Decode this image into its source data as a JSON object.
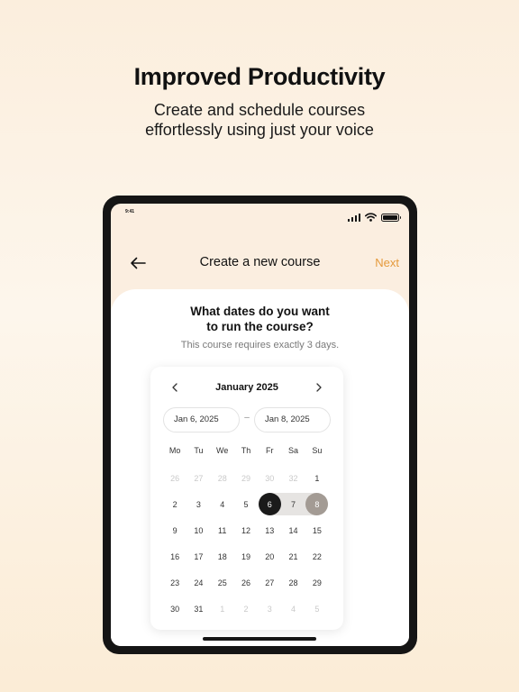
{
  "promo": {
    "headline": "Improved Productivity",
    "subline_1": "Create and schedule courses",
    "subline_2": "effortlessly using just your voice"
  },
  "status_bar": {
    "time": "9:41",
    "icons": [
      "signal-icon",
      "wifi-icon",
      "battery-icon"
    ]
  },
  "nav": {
    "title": "Create a new course",
    "next_label": "Next",
    "back_icon": "arrow-left-icon"
  },
  "question": {
    "line_1": "What dates do you want",
    "line_2": "to run the course?"
  },
  "hint": "This course requires exactly 3 days.",
  "calendar": {
    "month": "January 2025",
    "start_date": "Jan 6, 2025",
    "separator": "–",
    "end_date": "Jan 8, 2025",
    "weekdays": [
      "Mo",
      "Tu",
      "We",
      "Th",
      "Fr",
      "Sa",
      "Su"
    ],
    "weeks": [
      [
        "26",
        "27",
        "28",
        "29",
        "30",
        "32",
        "1"
      ],
      [
        "2",
        "3",
        "4",
        "5",
        "6",
        "7",
        "8"
      ],
      [
        "9",
        "10",
        "11",
        "12",
        "13",
        "14",
        "15"
      ],
      [
        "16",
        "17",
        "18",
        "19",
        "20",
        "21",
        "22"
      ],
      [
        "23",
        "24",
        "25",
        "26",
        "27",
        "28",
        "29"
      ],
      [
        "30",
        "31",
        "1",
        "2",
        "3",
        "4",
        "5"
      ]
    ],
    "selected_start": "6",
    "selected_end": "8"
  },
  "colors": {
    "accent": "#e59a3c",
    "selected_start": "#1a1a1a",
    "selected_end": "#a39b94",
    "range_band": "#e6e4e2",
    "muted_day": "#c9c9c9"
  }
}
